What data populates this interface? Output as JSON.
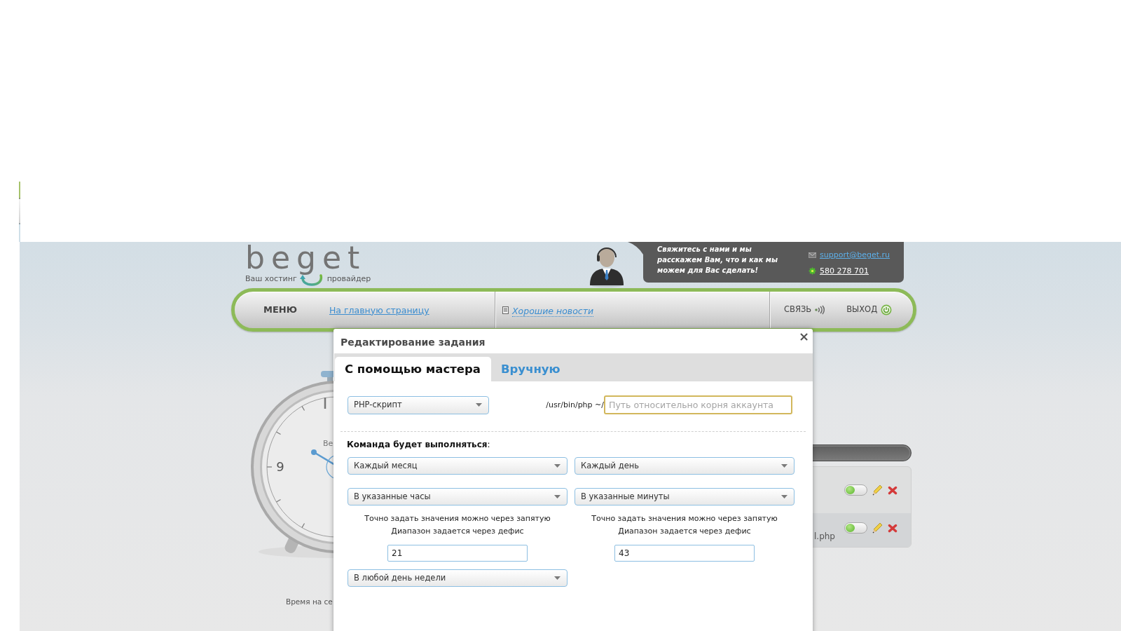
{
  "logo": {
    "wordmark": "beget",
    "tagline_left": "Ваш хостинг",
    "tagline_right": "провайдер"
  },
  "contact": {
    "message": [
      "Свяжитесь с нами и мы",
      "расскажем Вам, что и как мы",
      "можем для Вас сделать!"
    ],
    "email": "support@beget.ru",
    "icq": "580 278 701"
  },
  "nav": {
    "menu": "МЕНЮ",
    "home_link": "На главную страницу",
    "news_link": "Хорошие новости",
    "contact": "СВЯЗЬ",
    "logout": "ВЫХОД"
  },
  "clock": {
    "numeral": "9",
    "face_label": "Ве",
    "caption": "Время на се"
  },
  "task_list": {
    "rows": [
      {
        "enabled": true
      },
      {
        "name": "l.php",
        "enabled": true
      }
    ]
  },
  "dialog": {
    "title": "Редактирование задания",
    "close": "×",
    "tabs": [
      {
        "label": "С помощью мастера",
        "selected": true
      },
      {
        "label": "Вручную",
        "selected": false
      }
    ],
    "script_type": "PHP-скрипт",
    "interpreter": "/usr/bin/php ~/",
    "path_field": {
      "placeholder": "Путь относительно корня аккаунта",
      "focused": true
    },
    "schedule_label": "**Команда будет выполняться**:",
    "columns": [
      {
        "period": "Каждый месяц",
        "mode": "В указанные часы",
        "hints": [
          "Точно задать значения можно через запятую",
          "Диапазон задается через дефис"
        ],
        "value": "21"
      },
      {
        "period": "Каждый день",
        "mode": "В указанные минуты",
        "hints": [
          "Точно задать значения можно через запятую",
          "Диапазон задается через дефис"
        ],
        "value": "43"
      }
    ],
    "weekday": "В любой день недели"
  }
}
